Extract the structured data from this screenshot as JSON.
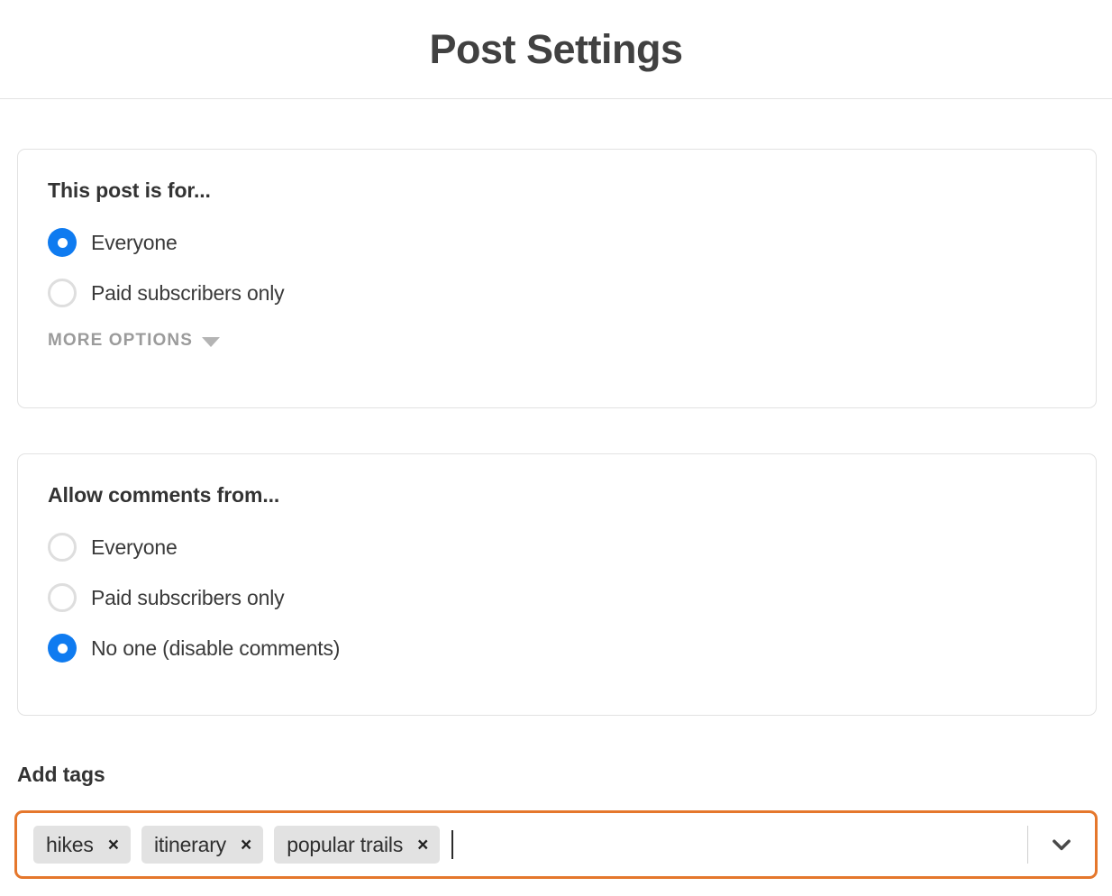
{
  "header": {
    "title": "Post Settings"
  },
  "colors": {
    "accent_blue": "#0f7bf0",
    "focus_orange": "#e5772c",
    "chip_gray": "#e2e2e2",
    "border_gray": "#e2e2e2",
    "text_dark": "#333333",
    "text_muted": "#9b9b9b"
  },
  "audience_card": {
    "heading": "This post is for...",
    "options": [
      {
        "label": "Everyone",
        "selected": true
      },
      {
        "label": "Paid subscribers only",
        "selected": false
      }
    ],
    "more_options_label": "MORE OPTIONS",
    "more_options_icon": "caret-down-icon"
  },
  "comments_card": {
    "heading": "Allow comments from...",
    "options": [
      {
        "label": "Everyone",
        "selected": false
      },
      {
        "label": "Paid subscribers only",
        "selected": false
      },
      {
        "label": "No one (disable comments)",
        "selected": true
      }
    ]
  },
  "tags_section": {
    "label": "Add tags",
    "placeholder": "",
    "value": "",
    "focused": true,
    "tags": [
      {
        "text": "hikes",
        "remove_glyph": "×"
      },
      {
        "text": "itinerary",
        "remove_glyph": "×"
      },
      {
        "text": "popular trails",
        "remove_glyph": "×"
      }
    ],
    "dropdown_icon": "chevron-down-icon"
  }
}
